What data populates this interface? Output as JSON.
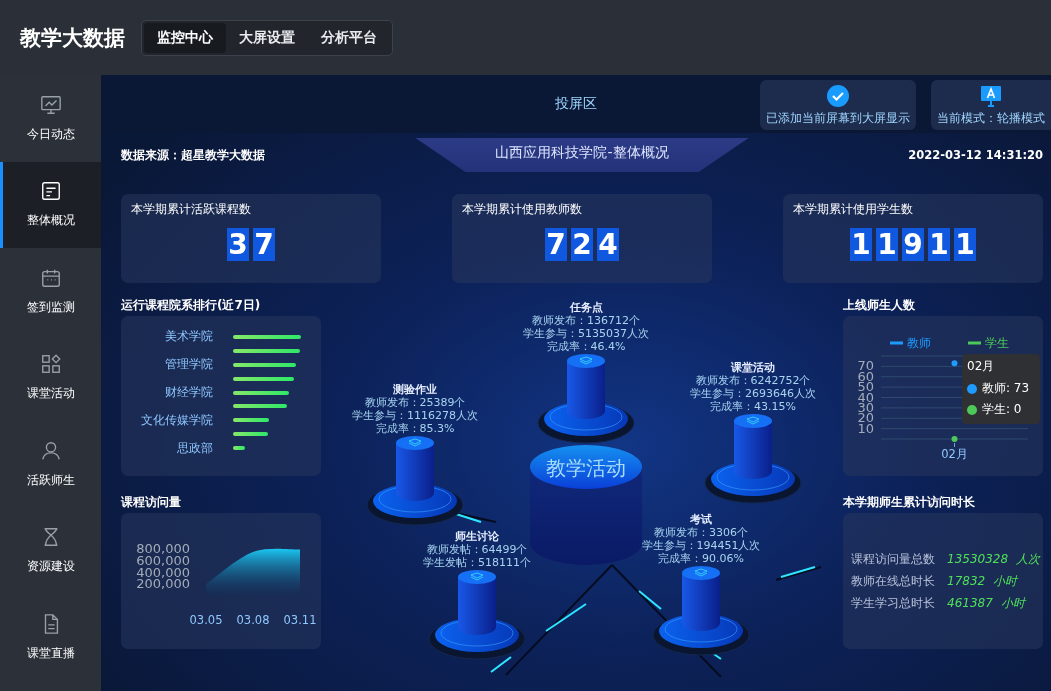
{
  "header": {
    "title": "教学大数据",
    "tabs": [
      {
        "label": "监控中心",
        "selected": true
      },
      {
        "label": "大屏设置",
        "selected": false
      },
      {
        "label": "分析平台",
        "selected": false
      }
    ]
  },
  "sidebar": {
    "items": [
      {
        "label": "今日动态",
        "selected": false
      },
      {
        "label": "整体概况",
        "selected": true
      },
      {
        "label": "签到监测",
        "selected": false
      },
      {
        "label": "课堂活动",
        "selected": false
      },
      {
        "label": "活跃师生",
        "selected": false
      },
      {
        "label": "资源建设",
        "selected": false
      },
      {
        "label": "课堂直播",
        "selected": false
      }
    ]
  },
  "topbar": {
    "title": "投屏区",
    "buttons": [
      {
        "label": "已添加当前屏幕到大屏显示",
        "kind": "check"
      },
      {
        "label": "当前模式：轮播模式",
        "kind": "monitor"
      }
    ]
  },
  "overview": {
    "source": "数据来源：超星教学大数据",
    "title": "山西应用科技学院-整体概况",
    "datetime": "2022-03-12 14:31:20"
  },
  "stats": [
    {
      "label": "本学期累计活跃课程数",
      "value": "37"
    },
    {
      "label": "本学期累计使用教师数",
      "value": "724"
    },
    {
      "label": "本学期累计使用学生数",
      "value": "11911"
    }
  ],
  "ranking": {
    "title": "运行课程院系排行(近7日)",
    "labels": [
      "美术学院",
      "管理学院",
      "财经学院",
      "文化传媒学院",
      "思政部"
    ]
  },
  "visits": {
    "title": "课程访问量",
    "chart_data": {
      "type": "area",
      "categories": [
        "03.05",
        "03.08",
        "03.11"
      ],
      "values": [
        200000,
        750000,
        790000
      ],
      "ylim": [
        0,
        800000
      ],
      "yticks": [
        {
          "value": 200000,
          "label": "200,000"
        },
        {
          "value": 400000,
          "label": "400,000"
        },
        {
          "value": 600000,
          "label": "600,000"
        },
        {
          "value": 800000,
          "label": "800,000"
        }
      ]
    }
  },
  "activity": {
    "center": "教学活动",
    "nodes": [
      {
        "title": "任务点",
        "lines": [
          "教师发布：136712个",
          "学生参与：5135037人次",
          "完成率：46.4%"
        ]
      },
      {
        "title": "测验作业",
        "lines": [
          "教师发布：25389个",
          "学生参与：1116278人次",
          "完成率：85.3%"
        ]
      },
      {
        "title": "课堂活动",
        "lines": [
          "教师发布：6242752个",
          "学生参与：2693646人次",
          "完成率：43.15%"
        ]
      },
      {
        "title": "师生讨论",
        "lines": [
          "教师发帖：64499个",
          "学生发帖：518111个"
        ]
      },
      {
        "title": "考试",
        "lines": [
          "教师发布：3306个",
          "学生参与：194451人次",
          "完成率：90.06%"
        ]
      }
    ]
  },
  "online": {
    "title": "上线师生人数",
    "chart_data": {
      "type": "line",
      "categories": [
        "02月"
      ],
      "series": [
        {
          "name": "教师",
          "color": "#1e9bff",
          "values": [
            73
          ],
          "marker": "circle"
        },
        {
          "name": "学生",
          "color": "#4dc95a",
          "values": [
            0
          ],
          "marker": "circle"
        }
      ],
      "ylim": [
        0,
        80
      ],
      "yticks": [
        10,
        20,
        30,
        40,
        50,
        60,
        70
      ],
      "grid": true,
      "legend": true
    },
    "tooltip": {
      "title": "02月",
      "items": [
        {
          "label": "教师: 73",
          "color": "#1e9bff"
        },
        {
          "label": "学生: 0",
          "color": "#4dc95a"
        }
      ]
    }
  },
  "duration": {
    "title": "本学期师生累计访问时长",
    "rows": [
      {
        "label": "课程访问量总数",
        "value": "13530328",
        "unit": "人次"
      },
      {
        "label": "教师在线总时长",
        "value": "17832",
        "unit": "小时"
      },
      {
        "label": "学生学习总时长",
        "value": "461387",
        "unit": "小时"
      }
    ]
  }
}
